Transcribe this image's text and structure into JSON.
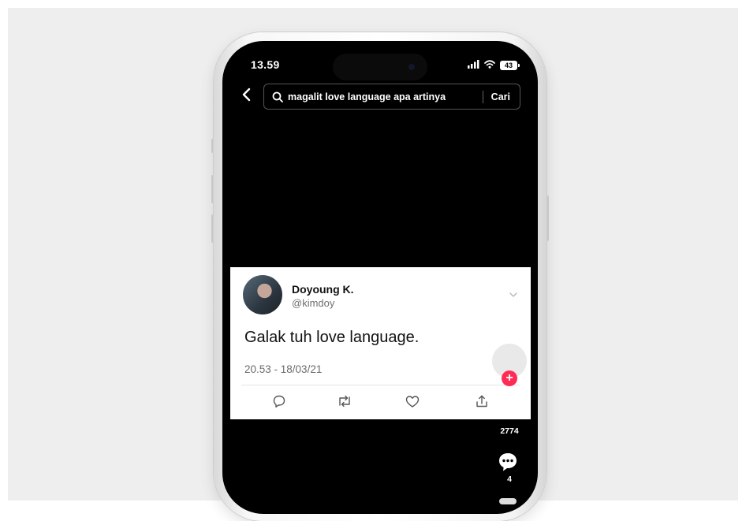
{
  "status_bar": {
    "time": "13.59",
    "battery": "43"
  },
  "search": {
    "query": "magalit love language apa artinya",
    "button_label": "Cari"
  },
  "tweet": {
    "author_name": "Doyoung K.",
    "author_handle": "@kimdoy",
    "text": "Galak tuh love language.",
    "timestamp": "20.53 - 18/03/21"
  },
  "sidebar": {
    "like_count": "2774",
    "comment_count": "4"
  },
  "colors": {
    "follow_accent": "#fe2c55",
    "screen_bg": "#000000"
  },
  "icons": [
    "back-arrow-icon",
    "search-icon",
    "signal-icon",
    "wifi-icon",
    "battery-icon",
    "chevron-down-icon",
    "reply-icon",
    "retweet-icon",
    "like-icon",
    "share-icon",
    "plus-icon",
    "comment-icon"
  ]
}
